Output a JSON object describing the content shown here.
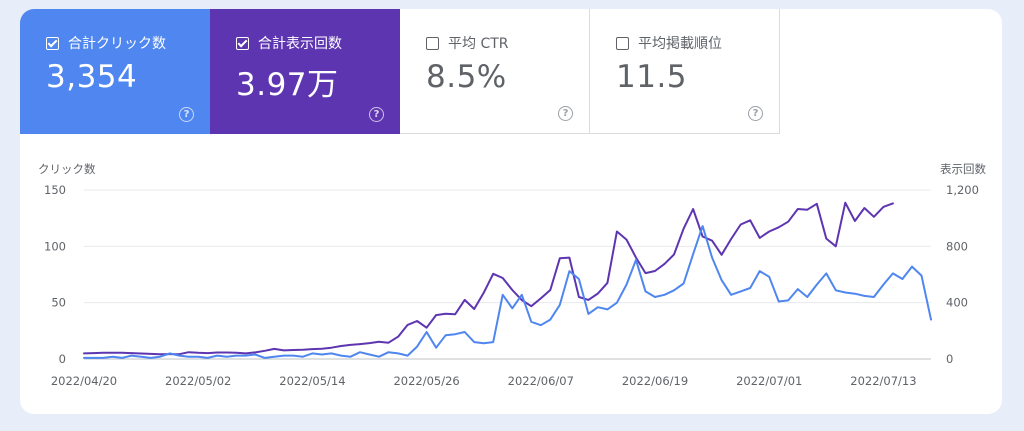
{
  "tiles": [
    {
      "label": "合計クリック数",
      "value": "3,354",
      "checked": true,
      "color": "#4f86ef"
    },
    {
      "label": "合計表示回数",
      "value": "3.97万",
      "checked": true,
      "color": "#5e35b1"
    },
    {
      "label": "平均 CTR",
      "value": "8.5%",
      "checked": false
    },
    {
      "label": "平均掲載順位",
      "value": "11.5",
      "checked": false
    }
  ],
  "help_glyph": "?",
  "chart_data": {
    "type": "line",
    "left_axis": {
      "title": "クリック数",
      "ticks": [
        "0",
        "50",
        "100",
        "150"
      ],
      "range": [
        0,
        150
      ]
    },
    "right_axis": {
      "title": "表示回数",
      "ticks": [
        "0",
        "400",
        "800",
        "1,200"
      ],
      "range": [
        0,
        1200
      ]
    },
    "x_tick_labels": [
      "2022/04/20",
      "2022/05/02",
      "2022/05/14",
      "2022/05/26",
      "2022/06/07",
      "2022/06/19",
      "2022/07/01",
      "2022/07/13"
    ],
    "x_start": "2022/04/20",
    "grid": true,
    "series": [
      {
        "key": "clicks",
        "color": "#4f86ef",
        "axis": "left",
        "values": [
          1,
          1,
          1,
          2,
          1,
          3,
          2,
          1,
          2,
          5,
          3,
          2,
          2,
          1,
          3,
          2,
          3,
          3,
          4,
          1,
          2,
          3,
          3,
          2,
          5,
          4,
          5,
          3,
          2,
          6,
          4,
          2,
          6,
          5,
          3,
          11,
          24,
          10,
          21,
          22,
          24,
          15,
          14,
          15,
          57,
          45,
          57,
          33,
          30,
          35,
          48,
          78,
          71,
          40,
          46,
          44,
          50,
          66,
          88,
          60,
          55,
          57,
          61,
          67,
          93,
          118,
          90,
          70,
          57,
          60,
          63,
          78,
          73,
          51,
          52,
          62,
          55,
          66,
          76,
          61,
          59,
          58,
          56,
          55,
          66,
          76,
          71,
          82,
          74,
          35
        ]
      },
      {
        "key": "impressions",
        "color": "#5e35b1",
        "axis": "right",
        "values": [
          40,
          42,
          44,
          45,
          44,
          42,
          39,
          36,
          34,
          35,
          34,
          48,
          44,
          42,
          46,
          46,
          44,
          40,
          47,
          58,
          72,
          61,
          64,
          66,
          70,
          73,
          80,
          92,
          100,
          106,
          113,
          122,
          116,
          158,
          242,
          270,
          222,
          312,
          322,
          318,
          420,
          355,
          470,
          605,
          575,
          490,
          418,
          375,
          430,
          490,
          715,
          720,
          440,
          420,
          465,
          540,
          905,
          848,
          720,
          610,
          625,
          675,
          742,
          925,
          1065,
          870,
          840,
          740,
          852,
          955,
          985,
          860,
          905,
          935,
          975,
          1065,
          1060,
          1102,
          855,
          800,
          1110,
          980,
          1072,
          1010,
          1080,
          1105
        ]
      }
    ]
  }
}
